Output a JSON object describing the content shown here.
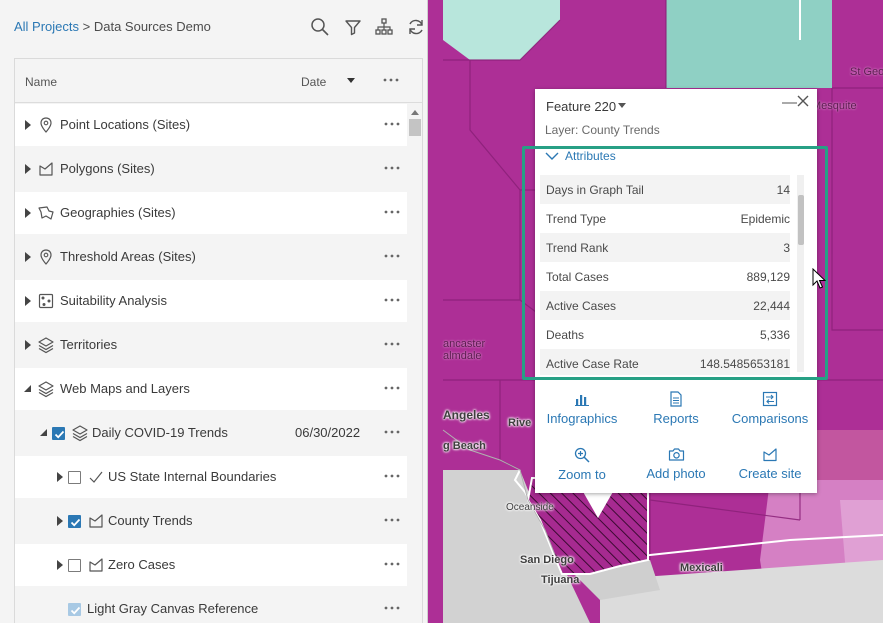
{
  "colors": {
    "accent": "#2b78b4",
    "highlight": "#27a085",
    "map_magenta": "#ad2f96",
    "map_teal": "#8fd0c4"
  },
  "header": {
    "breadcrumb_root": "All Projects",
    "breadcrumb_sep": " > ",
    "breadcrumb_current": "Data Sources Demo",
    "tools": [
      "search-icon",
      "filter-icon",
      "hierarchy-icon",
      "refresh-icon"
    ]
  },
  "columns": {
    "name": "Name",
    "date": "Date"
  },
  "rows": [
    {
      "label": "Point Locations (Sites)",
      "icon": "pin-icon"
    },
    {
      "label": "Polygons (Sites)",
      "icon": "polygon-icon"
    },
    {
      "label": "Geographies (Sites)",
      "icon": "geography-icon"
    },
    {
      "label": "Threshold Areas (Sites)",
      "icon": "pin-icon"
    },
    {
      "label": "Suitability Analysis",
      "icon": "suitability-icon"
    },
    {
      "label": "Territories",
      "icon": "layers-icon"
    },
    {
      "label": "Web Maps and Layers",
      "icon": "layers-icon",
      "expanded": true
    },
    {
      "label": "Daily COVID-19 Trends",
      "icon": "layers-icon",
      "date": "06/30/2022",
      "checked": true,
      "expanded": true
    },
    {
      "label": "US State Internal Boundaries",
      "icon": "line-icon",
      "checked": false
    },
    {
      "label": "County Trends",
      "icon": "polygon-icon",
      "checked": true
    },
    {
      "label": "Zero Cases",
      "icon": "polygon-icon",
      "checked": false
    },
    {
      "label": "Light Gray Canvas Reference",
      "checked": true
    }
  ],
  "popup": {
    "title": "Feature 220",
    "layer": "Layer: County Trends",
    "attributes_label": "Attributes",
    "attributes": [
      {
        "key": "Days in Graph Tail",
        "value": "14"
      },
      {
        "key": "Trend Type",
        "value": "Epidemic"
      },
      {
        "key": "Trend Rank",
        "value": "3"
      },
      {
        "key": "Total Cases",
        "value": "889,129"
      },
      {
        "key": "Active Cases",
        "value": "22,444"
      },
      {
        "key": "Deaths",
        "value": "5,336"
      },
      {
        "key": "Active Case Rate",
        "value": "148.5485653181"
      }
    ],
    "actions": [
      {
        "label": "Infographics",
        "icon": "bar-chart-icon"
      },
      {
        "label": "Reports",
        "icon": "report-icon"
      },
      {
        "label": "Comparisons",
        "icon": "comparison-icon"
      },
      {
        "label": "Zoom to",
        "icon": "zoom-icon"
      },
      {
        "label": "Add photo",
        "icon": "camera-icon"
      },
      {
        "label": "Create site",
        "icon": "create-site-icon"
      }
    ]
  },
  "map": {
    "labels": [
      "St Geo",
      "Mesquite",
      "ancaster",
      "almdale",
      "Angeles",
      "Rive",
      "g Beach",
      "Oceanside",
      "San Diego",
      "Tijuana",
      "Mexicali"
    ]
  }
}
